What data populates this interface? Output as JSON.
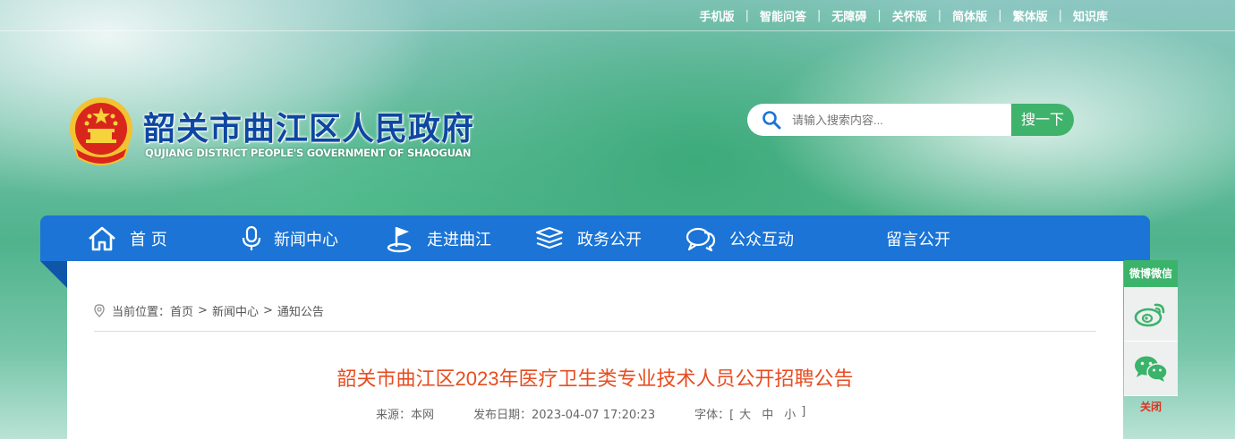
{
  "top_links": [
    "手机版",
    "智能问答",
    "无障碍",
    "关怀版",
    "简体版",
    "繁体版",
    "知识库"
  ],
  "site": {
    "title": "韶关市曲江区人民政府",
    "subtitle": "QUJIANG DISTRICT PEOPLE'S GOVERNMENT OF SHAOGUAN"
  },
  "search": {
    "placeholder": "请输入搜索内容...",
    "button": "搜一下"
  },
  "nav": [
    {
      "label": "首 页",
      "icon": "home-icon"
    },
    {
      "label": "新闻中心",
      "icon": "microphone-icon"
    },
    {
      "label": "走进曲江",
      "icon": "flag-icon"
    },
    {
      "label": "政务公开",
      "icon": "layers-icon"
    },
    {
      "label": "公众互动",
      "icon": "chat-bubble-icon"
    },
    {
      "label": "留言公开",
      "icon": ""
    }
  ],
  "breadcrumb": {
    "prefix": "当前位置：",
    "items": [
      "首页",
      "新闻中心",
      "通知公告"
    ],
    "separator": ">"
  },
  "article": {
    "title": "韶关市曲江区2023年医疗卫生类专业技术人员公开招聘公告",
    "source_label": "来源：本网",
    "date_label": "发布日期：2023-04-07 17:20:23",
    "font_label": "字体：[",
    "font_large": "大",
    "font_medium": "中",
    "font_small": "小",
    "font_end": "]"
  },
  "side_widget": {
    "header": "微博微信",
    "close": "关闭"
  },
  "colors": {
    "nav_bg": "#1b74d6",
    "title_red": "#e84c20",
    "green": "#3bb36a"
  }
}
